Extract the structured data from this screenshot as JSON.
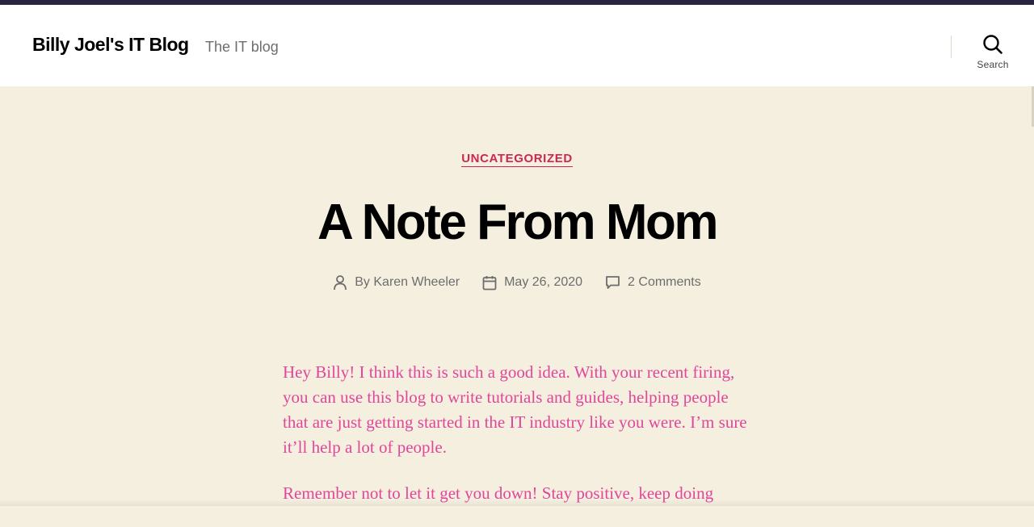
{
  "header": {
    "site_title": "Billy Joel's IT Blog",
    "site_description": "The IT blog",
    "search_label": "Search"
  },
  "post": {
    "category": "UNCATEGORIZED",
    "title": "A Note From Mom",
    "meta": {
      "author_prefix": "By",
      "author": "Karen Wheeler",
      "date": "May 26, 2020",
      "comments": "2 Comments"
    },
    "paragraphs": [
      "Hey Billy!  I think this is such a good idea.  With your recent firing, you can use this blog to write tutorials and guides, helping people that are just getting started in the IT industry like you were.  I’m sure it’ll help a lot of people.",
      "Remember not to let it get you down!  Stay positive, keep doing"
    ]
  },
  "colors": {
    "accent": "#cd2653",
    "background": "#f5efe0",
    "header_background": "#ffffff",
    "top_bar": "#2b2440",
    "content_text": "#e0479a",
    "meta_text": "#6d6d6d"
  },
  "icons": {
    "search": "search-icon",
    "author": "person-icon",
    "date": "calendar-icon",
    "comments": "comment-bubble-icon"
  }
}
